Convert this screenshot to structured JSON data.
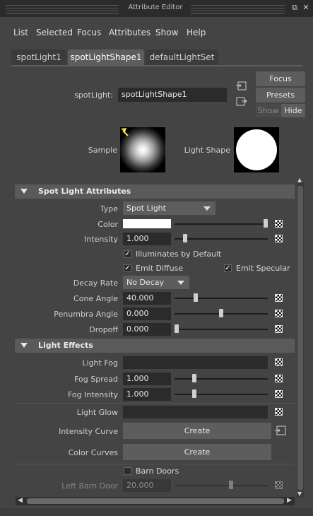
{
  "window": {
    "title": "Attribute Editor"
  },
  "menu": [
    "List",
    "Selected",
    "Focus",
    "Attributes",
    "Show",
    "Help"
  ],
  "tabs": [
    "spotLight1",
    "spotLightShape1",
    "defaultLightSet"
  ],
  "active_tab": 1,
  "node": {
    "label": "spotLight:",
    "value": "spotLightShape1"
  },
  "buttons": {
    "focus": "Focus",
    "presets": "Presets",
    "show": "Show",
    "hide": "Hide"
  },
  "preview": {
    "sample_label": "Sample",
    "shape_label": "Light Shape"
  },
  "spot_section": {
    "title": "Spot Light Attributes",
    "type_label": "Type",
    "type_value": "Spot Light",
    "color_label": "Color",
    "color_value": "#ffffff",
    "intensity_label": "Intensity",
    "intensity_value": "1.000",
    "illuminates_label": "Illuminates by Default",
    "illuminates": true,
    "emit_diffuse_label": "Emit Diffuse",
    "emit_diffuse": true,
    "emit_specular_label": "Emit Specular",
    "emit_specular": true,
    "decay_label": "Decay Rate",
    "decay_value": "No Decay",
    "cone_label": "Cone Angle",
    "cone_value": "40.000",
    "penumbra_label": "Penumbra Angle",
    "penumbra_value": "0.000",
    "dropoff_label": "Dropoff",
    "dropoff_value": "0.000"
  },
  "effects_section": {
    "title": "Light Effects",
    "fog_label": "Light Fog",
    "fog_value": "",
    "fog_spread_label": "Fog Spread",
    "fog_spread_value": "1.000",
    "fog_intensity_label": "Fog Intensity",
    "fog_intensity_value": "1.000",
    "glow_label": "Light Glow",
    "glow_value": "",
    "intensity_curve_label": "Intensity Curve",
    "intensity_curve_btn": "Create",
    "color_curves_label": "Color Curves",
    "color_curves_btn": "Create",
    "barn_doors_label": "Barn Doors",
    "barn_doors": false,
    "left_barn_label": "Left Barn Door",
    "left_barn_value": "20.000"
  }
}
